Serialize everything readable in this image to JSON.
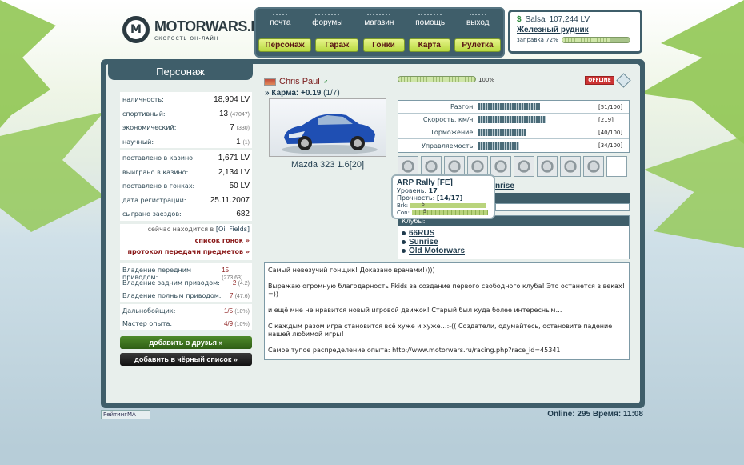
{
  "brand": {
    "title": "MOTORWARS.RU",
    "subtitle": "СКОРОСТЬ ОН-ЛАЙН",
    "mark": "M"
  },
  "nav": {
    "top": [
      "почта",
      "форумы",
      "магазин",
      "помощь",
      "выход"
    ],
    "main": [
      "Персонаж",
      "Гараж",
      "Гонки",
      "Карта",
      "Рулетка"
    ]
  },
  "user": {
    "name": "Salsa",
    "money": "107,244 LV",
    "location": "Железный рудник",
    "fuel_label": "заправка 72%",
    "fuel_level": 72
  },
  "sidebar": {
    "title": "Персонаж",
    "group1": [
      {
        "label": "наличность:",
        "value": "18,904 LV",
        "extra": ""
      },
      {
        "label": "спортивный:",
        "value": "13",
        "extra": "(47047)"
      },
      {
        "label": "экономический:",
        "value": "7",
        "extra": "(330)"
      },
      {
        "label": "научный:",
        "value": "1",
        "extra": "(1)"
      }
    ],
    "group2": [
      {
        "label": "поставлено в казино:",
        "value": "1,671 LV"
      },
      {
        "label": "выиграно в казино:",
        "value": "2,134 LV"
      },
      {
        "label": "поставлено в гонках:",
        "value": "50 LV"
      },
      {
        "label": "дата регистрации:",
        "value": "25.11.2007"
      },
      {
        "label": "сыграно заездов:",
        "value": "682"
      }
    ],
    "location_prefix": "сейчас находится в",
    "location": "[Oil Fields]",
    "race_list_link": "список гонок »",
    "transfer_link": "протокол передачи предметов »",
    "group3": [
      {
        "label": "Владение передним приводом:",
        "value": "15",
        "extra": "(273.63)"
      },
      {
        "label": "Владение задним приводом:",
        "value": "2",
        "extra": "(4.2)"
      },
      {
        "label": "Владение полным приводом:",
        "value": "7",
        "extra": "(47.6)"
      }
    ],
    "group4": [
      {
        "label": "Дальнобойщик:",
        "value": "1/5",
        "extra": "(10%)"
      },
      {
        "label": "Мастер опыта:",
        "value": "4/9",
        "extra": "(10%)"
      }
    ],
    "add_friend": "добавить в друзья »",
    "add_blacklist": "добавить в чёрный список »"
  },
  "profile": {
    "name": "Chris Paul",
    "karma_label": "» Карма:",
    "karma_value": "+0.19",
    "karma_extra": "(1/7)",
    "car_name": "Mazda 323 1.6[20]",
    "progress_pct": "100%",
    "progress_level": 100,
    "status": "OFFLINE"
  },
  "stats": [
    {
      "label": "Разгон:",
      "value": "[51/100]",
      "level": 51
    },
    {
      "label": "Скорость, км/ч:",
      "value": "[219]",
      "level": 56
    },
    {
      "label": "Торможение:",
      "value": "[40/100]",
      "level": 40
    },
    {
      "label": "Управляемость:",
      "value": "[34/100]",
      "level": 34
    }
  ],
  "parts": [
    "suspension",
    "brake-disc",
    "seats",
    "exhaust",
    "wheel",
    "gearbox",
    "turbo",
    "engine",
    "pistons",
    "empty"
  ],
  "tooltip": {
    "title": "ARP Rally [FE]",
    "level_label": "Уровень:",
    "level": "17",
    "durability_label": "Прочность:",
    "durability": "[14/17]",
    "brk_label": "Brk:",
    "brk": "5",
    "con_label": "Con:",
    "con": "5"
  },
  "team_fragment": "nrise",
  "clubs": {
    "header": "Клубы:",
    "items": [
      "66RUS",
      "Sunrise",
      "Old Motorwars"
    ]
  },
  "about": [
    "Самый невезучий гонщик! Доказано врачами!))))",
    "Выражаю огромную благодарность Fkids за создание первого свободного клуба! Это останется в веках! =))",
    "и ещё мне не нравится новый игровой движок! Старый был куда более интересным…",
    "С каждым разом игра становится всё хуже и хуже…:-(( Создатели, одумайтесь, остановите падение нашей любимой игры!",
    "Самое тупое распределение опыта: http://www.motorwars.ru/racing.php?race_id=45341"
  ],
  "footer": {
    "rating_button": "РейтингMA",
    "online": "Online: 295  Время: 11:08"
  },
  "colors": {
    "dark": "#3f5e6a",
    "accent_green": "#b8d940",
    "link_red": "#8a1a1a"
  }
}
